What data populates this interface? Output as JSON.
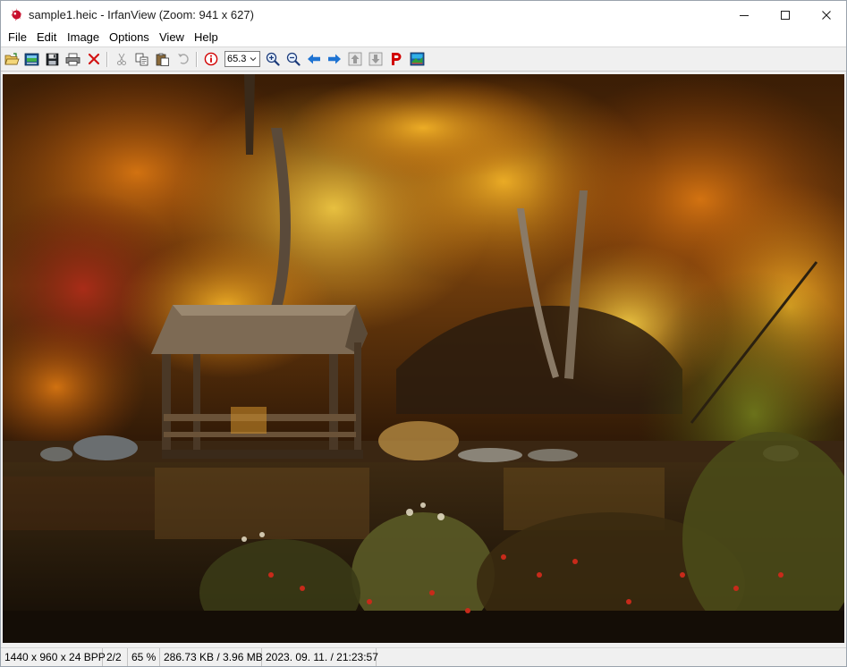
{
  "window": {
    "title": "sample1.heic - IrfanView (Zoom: 941 x 627)"
  },
  "menu": {
    "items": [
      "File",
      "Edit",
      "Image",
      "Options",
      "View",
      "Help"
    ]
  },
  "toolbar": {
    "icons": [
      "open-folder-icon",
      "thumbnails-icon",
      "save-icon",
      "print-icon",
      "delete-icon",
      "cut-icon",
      "copy-icon",
      "paste-icon",
      "undo-icon",
      "info-icon",
      "zoom-in-icon",
      "zoom-out-icon",
      "previous-icon",
      "next-icon",
      "first-icon",
      "last-icon",
      "paint-icon",
      "about-icon"
    ],
    "zoom_value": "65.3"
  },
  "viewer": {
    "description_icon": "autumn-pond-gazebo-photo"
  },
  "status": {
    "dimensions": "1440 x 960 x 24 BPP",
    "index": "2/2",
    "zoom": "65 %",
    "size": "286.73 KB / 3.96 MB",
    "datetime": "2023. 09. 11. / 21:23:57"
  },
  "colors": {
    "accent_blue": "#1e73d2",
    "delete_red": "#d21414",
    "info_red": "#d10000"
  }
}
